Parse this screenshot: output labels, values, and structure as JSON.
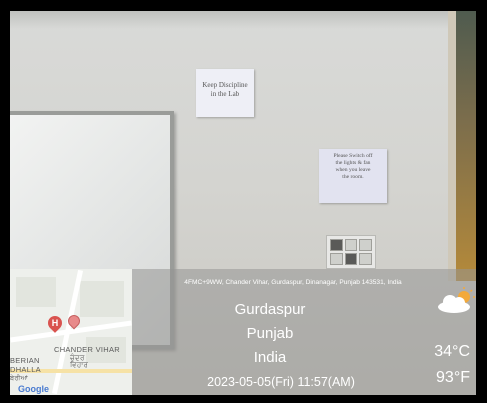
{
  "signs": {
    "discipline_line1": "Keep Discipline",
    "discipline_line2": "in the Lab",
    "switch_line1": "Please Switch off",
    "switch_line2": "the lights & fan",
    "switch_line3": "when you leave",
    "switch_line4": "the room."
  },
  "map": {
    "label_chander_vihar": "CHANDER VIHAR",
    "label_chander_vihar_pa": "ਚੰਦਰ",
    "label_vihar_pa": "ਵਿਹਾਰ",
    "label_berian": "BERIAN",
    "label_dhalla": "DHALLA",
    "label_berian_pa": "ਬੇਰੀਆਂ",
    "google": "Google",
    "hospital_marker": "H"
  },
  "location": {
    "address": "4FMC+9WW, Chander Vihar, Gurdaspur, Dinanagar, Punjab 143531, India",
    "city": "Gurdaspur",
    "state": "Punjab",
    "country": "India",
    "datetime": "2023-05-05(Fri)  11:57(AM)"
  },
  "weather": {
    "icon": "partly-cloudy-icon",
    "temp_c": "34°C",
    "temp_f": "93°F"
  }
}
